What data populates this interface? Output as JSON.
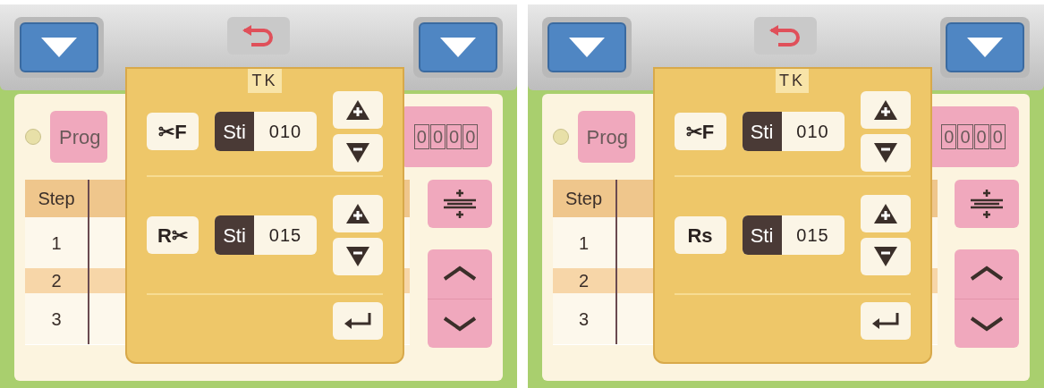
{
  "panels": [
    {
      "prog_label": "Prog",
      "counter_digits": [
        "0",
        "0",
        "0",
        "0"
      ],
      "table": {
        "header": "Step",
        "rows": [
          {
            "step": "1",
            "selected": false
          },
          {
            "step": "2",
            "selected": true
          },
          {
            "step": "3",
            "selected": false
          }
        ]
      },
      "dialog": {
        "title": "TK",
        "rows": [
          {
            "mode": "✂F",
            "unit": "Sti",
            "value": "010"
          },
          {
            "mode": "R✂",
            "unit": "Sti",
            "value": "015"
          }
        ]
      }
    },
    {
      "prog_label": "Prog",
      "counter_digits": [
        "0",
        "0",
        "0",
        "0"
      ],
      "table": {
        "header": "Step",
        "rows": [
          {
            "step": "1",
            "selected": false
          },
          {
            "step": "2",
            "selected": true
          },
          {
            "step": "3",
            "selected": false
          }
        ]
      },
      "dialog": {
        "title": "TK",
        "rows": [
          {
            "mode": "✂F",
            "unit": "Sti",
            "value": "010"
          },
          {
            "mode": "Rs",
            "unit": "Sti",
            "value": "015"
          }
        ]
      }
    }
  ]
}
